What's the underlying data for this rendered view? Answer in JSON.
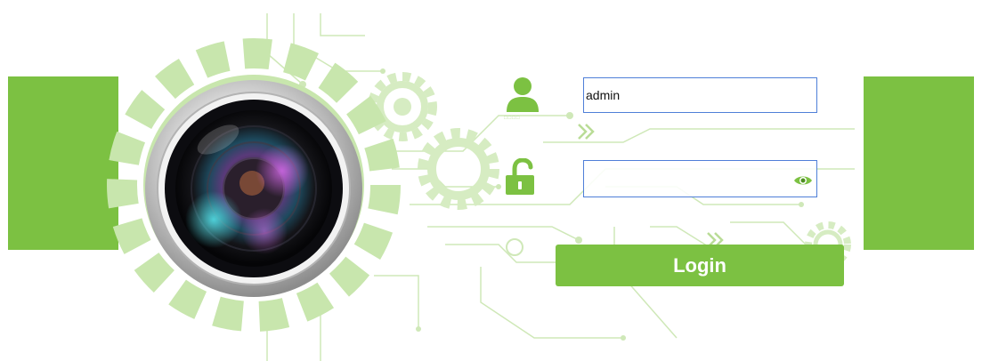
{
  "login_form": {
    "username_value": "admin",
    "password_value": "",
    "user_caption": "□□□□",
    "login_label": "Login"
  },
  "icons": {
    "user": "user-icon",
    "lock": "unlocked-padlock-icon",
    "password_toggle": "eye-icon",
    "camera": "camera-lens-icon",
    "gear": "gear-icon"
  },
  "colors": {
    "accent": "#7cc142",
    "light_accent": "#c8e6ad",
    "input_border": "#4f7fd8",
    "background": "#ffffff"
  }
}
